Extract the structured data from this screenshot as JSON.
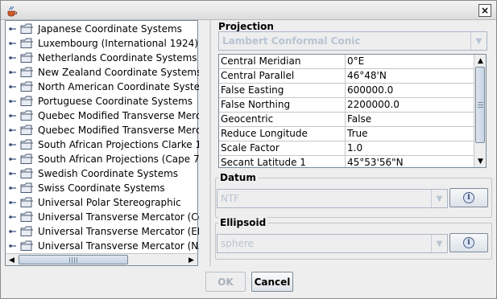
{
  "window": {
    "close_label": "×",
    "app_icon": "java-cup-icon"
  },
  "tree": {
    "items": [
      {
        "label": "Japanese Coordinate Systems"
      },
      {
        "label": "Luxembourg (International 1924)"
      },
      {
        "label": "Netherlands Coordinate Systems"
      },
      {
        "label": "New Zealand Coordinate Systems"
      },
      {
        "label": "North American Coordinate Systems"
      },
      {
        "label": "Portuguese Coordinate Systems"
      },
      {
        "label": "Quebec Modified Transverse Mercato"
      },
      {
        "label": "Quebec Modified Transverse Mercato"
      },
      {
        "label": "South African Projections Clarke 188"
      },
      {
        "label": "South African Projections (Cape 7-pa"
      },
      {
        "label": "Swedish Coordinate Systems"
      },
      {
        "label": "Swiss Coordinate Systems"
      },
      {
        "label": "Universal Polar Stereographic"
      },
      {
        "label": "Universal Transverse Mercator (Corre"
      },
      {
        "label": "Universal Transverse Mercator (ED 5"
      },
      {
        "label": "Universal Transverse Mercator (NAD"
      }
    ],
    "icons": {
      "handle": "tree-expand-icon",
      "folder": "folder-icon"
    }
  },
  "projection": {
    "title": "Projection",
    "selected": "Lambert Conformal Conic",
    "parameters": [
      {
        "name": "Central Meridian",
        "value": "0°E"
      },
      {
        "name": "Central Parallel",
        "value": "46°48'N"
      },
      {
        "name": "False Easting",
        "value": "600000.0"
      },
      {
        "name": "False Northing",
        "value": "2200000.0"
      },
      {
        "name": "Geocentric",
        "value": "False"
      },
      {
        "name": "Reduce Longitude",
        "value": "True"
      },
      {
        "name": "Scale Factor",
        "value": "1.0"
      },
      {
        "name": "Secant Latitude 1",
        "value": "45°53'56\"N"
      }
    ]
  },
  "datum": {
    "title": "Datum",
    "selected": "NTF"
  },
  "ellipsoid": {
    "title": "Ellipsoid",
    "selected": "sphere"
  },
  "buttons": {
    "ok": "OK",
    "cancel": "Cancel"
  },
  "colors": {
    "disabled_text": "#b8c4d2",
    "frame": "#7a8a99"
  }
}
